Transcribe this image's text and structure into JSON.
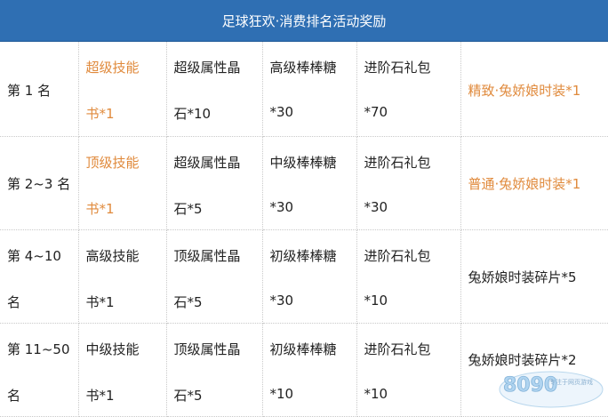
{
  "header": {
    "title": "足球狂欢·消费排名活动奖励"
  },
  "rows": [
    {
      "rank": [
        "第 1 名",
        ""
      ],
      "skill": [
        "超级技能",
        "书*1"
      ],
      "attr": [
        "超级属性晶",
        "石*10"
      ],
      "candy": [
        "高级棒棒糖",
        "*30"
      ],
      "stone": [
        "进阶石礼包",
        "*70"
      ],
      "costume": "精致·兔娇娘时装*1",
      "highlight": true
    },
    {
      "rank": [
        "第 2~3 名",
        ""
      ],
      "skill": [
        "顶级技能",
        "书*1"
      ],
      "attr": [
        "超级属性晶",
        "石*5"
      ],
      "candy": [
        "中级棒棒糖",
        "*30"
      ],
      "stone": [
        "进阶石礼包",
        "*30"
      ],
      "costume": "普通·兔娇娘时装*1",
      "highlight": true
    },
    {
      "rank": [
        "第 4~10",
        "名"
      ],
      "skill": [
        "高级技能",
        "书*1"
      ],
      "attr": [
        "顶级属性晶",
        "石*5"
      ],
      "candy": [
        "初级棒棒糖",
        "*30"
      ],
      "stone": [
        "进阶石礼包",
        "*10"
      ],
      "costume": "兔娇娘时装碎片*5",
      "highlight": false
    },
    {
      "rank": [
        "第 11~50",
        "名"
      ],
      "skill": [
        "中级技能",
        "书*1"
      ],
      "attr": [
        "顶级属性晶",
        "石*5"
      ],
      "candy": [
        "初级棒棒糖",
        "*10"
      ],
      "stone": [
        "进阶石礼包",
        "*10"
      ],
      "costume": "兔娇娘时装碎片*2",
      "highlight": false
    }
  ],
  "watermark": {
    "logo_text": "8090",
    "tagline": "专注于网页游戏"
  },
  "colors": {
    "title_bg": "#2f6fb3",
    "highlight": "#e08a3c"
  }
}
